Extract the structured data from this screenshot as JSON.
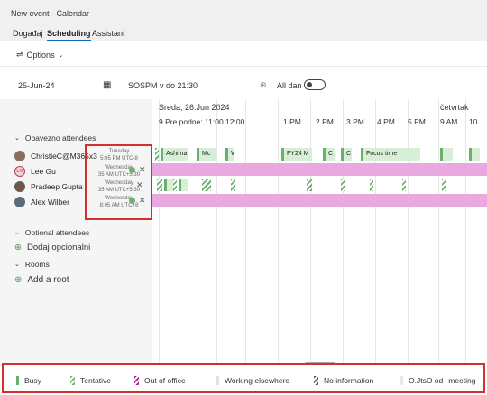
{
  "window": {
    "title": "New event - Calendar"
  },
  "menu": {
    "tabs": [
      "Događaj",
      "Scheduling",
      "Assistant"
    ]
  },
  "toolbar": {
    "options_label": "Options"
  },
  "datebar": {
    "date": "25-Jun-24",
    "time_text": "SOSPM v do 21:30",
    "allday_label": "All dan"
  },
  "left": {
    "required_head": "Obavezno attendees",
    "attendees": [
      {
        "name": "ChristieC@M365x3",
        "initials": "",
        "avatar_color": "#8a6d5a"
      },
      {
        "name": "Lee Gu",
        "initials": "LG",
        "avatar_color": "#c0395a"
      },
      {
        "name": "Pradeep Gupta",
        "initials": "",
        "avatar_color": "#6b5a4a"
      },
      {
        "name": "Alex Wilber",
        "initials": "",
        "avatar_color": "#5a6b7a"
      }
    ],
    "tz_cards": [
      {
        "day": "Tuesday",
        "time": "5:05 PM UTC-8"
      },
      {
        "day": "Wednesday",
        "time": "35 AM UTC+5:30"
      },
      {
        "day": "Wednesday",
        "time": "35 AM UTC+5:30"
      },
      {
        "day": "Wednesday",
        "time": "8:05 AM UTC+8"
      }
    ],
    "optional_head": "Optional attendees",
    "add_optional": "Dodaj opcionalni",
    "rooms_head": "Rooms",
    "add_room": "Add a root"
  },
  "grid": {
    "date1": "Sreda, 26.Jun 2024",
    "date2": "četvrtak",
    "time_first": "9 Pre podne: 11:00 12:00",
    "times": [
      "1 PM",
      "2 PM",
      "3 PM",
      "4 PM",
      "5 PM",
      "9 AM",
      "10"
    ],
    "events": [
      "Ashima",
      "Mc",
      "W",
      "FY24 M",
      "C",
      "C",
      "Focus time"
    ]
  },
  "legend": {
    "busy": "Busy",
    "tentative": "Tentative",
    "out_of_office": "Out of office",
    "working_elsewhere": "Working elsewhere",
    "no_information": "No information",
    "outside": "O.JtsO od",
    "meeting": "meeting"
  },
  "colors": {
    "busy": "#6bb06b",
    "ooo": "#e9a8e0",
    "highlight": "#d32f2f",
    "accent": "#0f6cbd"
  }
}
